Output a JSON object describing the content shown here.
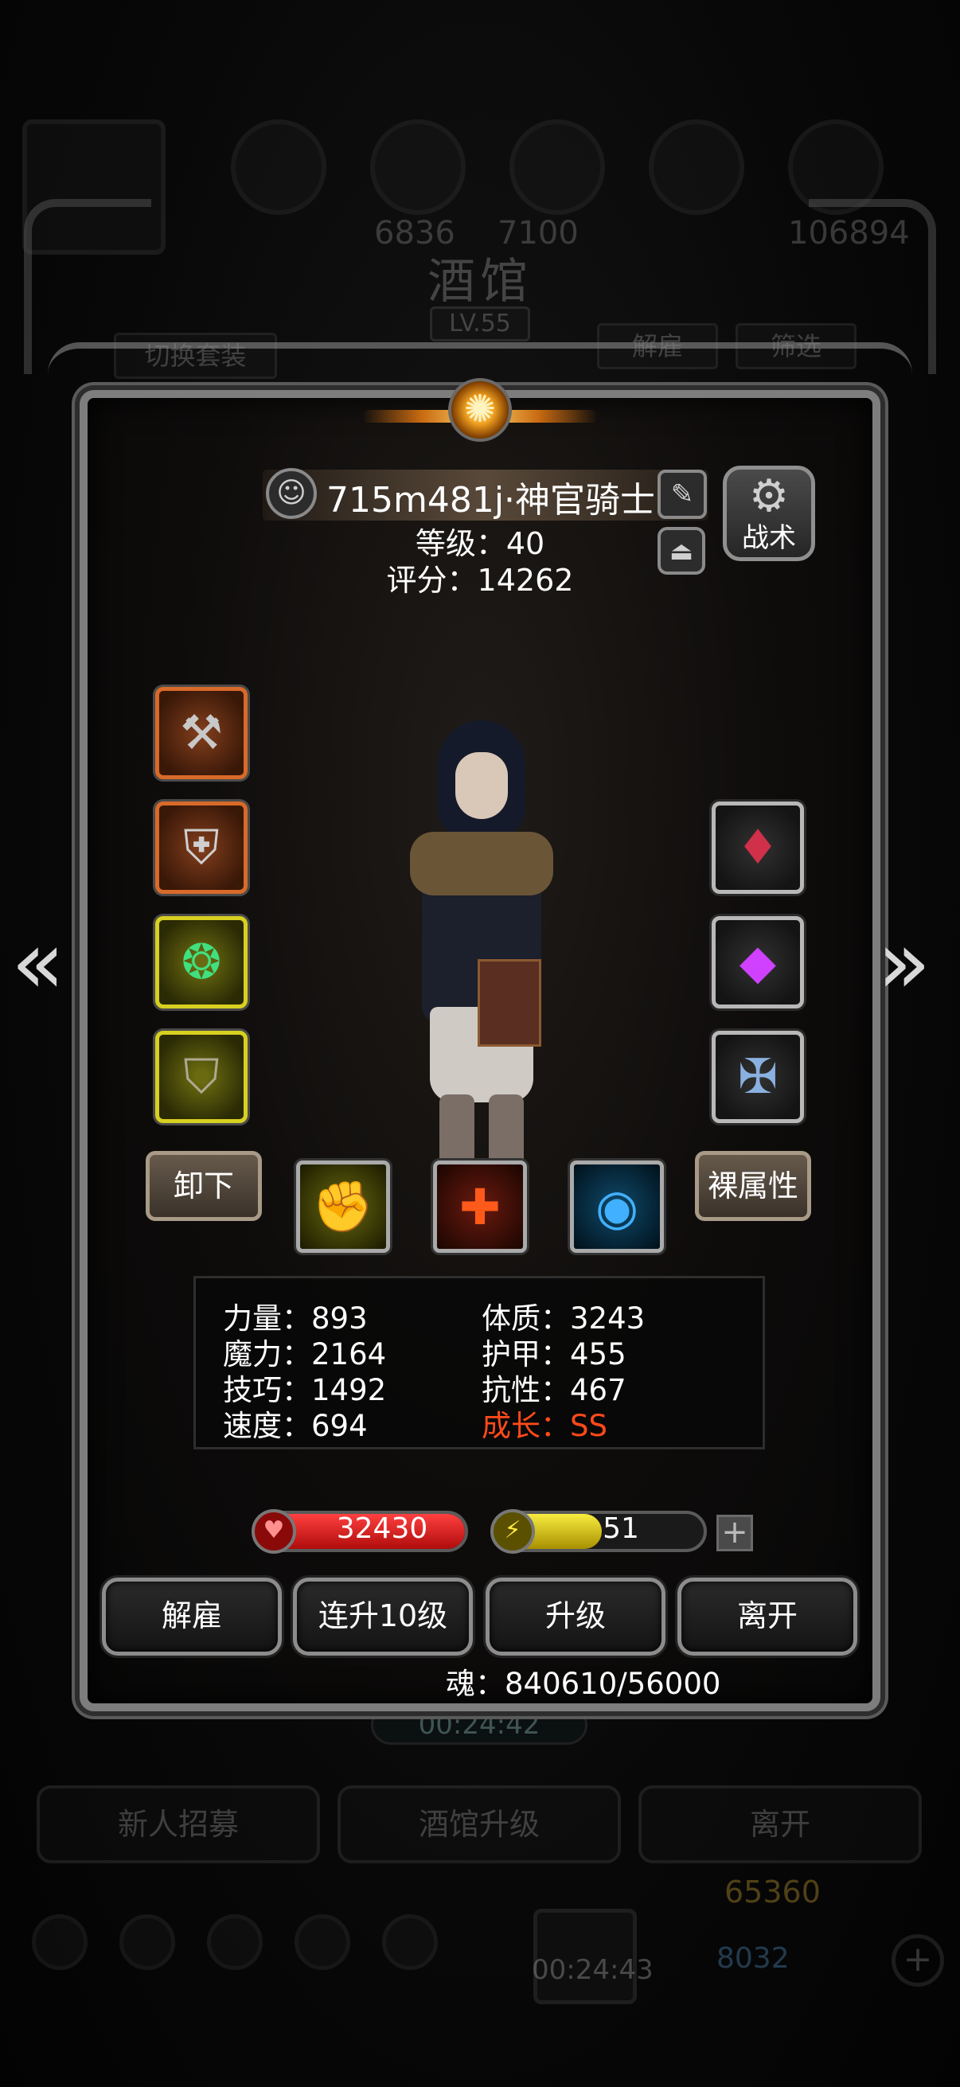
{
  "background": {
    "title": "酒馆",
    "level": "LV.55",
    "switch_outfit": "切换套装",
    "dismiss": "解雇",
    "filter": "筛选",
    "stats": [
      "6836",
      "7100",
      "106894"
    ],
    "timer": "00:24:42",
    "timer2": "00:24:43",
    "recruit": "新人招募",
    "tavern_upgrade": "酒馆升级",
    "leave": "离开",
    "gold": "65360",
    "gems": "8032"
  },
  "hero": {
    "name": "715m481j·神官骑士",
    "level_text": "等级：40",
    "score_text": "评分：14262",
    "tactics_label": "战术"
  },
  "equipment": {
    "left": [
      {
        "icon": "hammer-icon",
        "glyph": "⚒",
        "rarity": "orange"
      },
      {
        "icon": "armor-icon",
        "glyph": "⛨",
        "rarity": "orange"
      },
      {
        "icon": "necklace-icon",
        "glyph": "❂",
        "rarity": "yellow"
      },
      {
        "icon": "shield-icon",
        "glyph": "⛉",
        "rarity": "yellow"
      }
    ],
    "right": [
      {
        "icon": "red-gem-icon",
        "glyph": "♦",
        "rarity": "dark",
        "color": "#d0304a"
      },
      {
        "icon": "purple-gem-icon",
        "glyph": "◆",
        "rarity": "dark",
        "color": "#d040ff"
      },
      {
        "icon": "sword-emblem-icon",
        "glyph": "✠",
        "rarity": "dark",
        "color": "#8ab0e0"
      }
    ]
  },
  "actions": {
    "unequip": "卸下",
    "base_attr": "裸属性",
    "skills": [
      {
        "icon": "fist-skill-icon",
        "glyph": "✊",
        "color": "#e8e020",
        "bg": "#3a3a05"
      },
      {
        "icon": "heal-cross-skill-icon",
        "glyph": "✚",
        "color": "#ff5a1a",
        "bg": "#3a0a05"
      },
      {
        "icon": "eye-skill-icon",
        "glyph": "◉",
        "color": "#40b0ff",
        "bg": "#05203a"
      }
    ]
  },
  "stats": {
    "strength": "力量：893",
    "magic": "魔力：2164",
    "skill": "技巧：1492",
    "speed": "速度：694",
    "constitution": "体质：3243",
    "armor": "护甲：455",
    "resistance": "抗性：467",
    "growth": "成长：SS"
  },
  "bars": {
    "hp": "32430",
    "hp_fill": 1.0,
    "energy": "51",
    "energy_fill": 0.51
  },
  "buttons": {
    "dismiss": "解雇",
    "upgrade10": "连升10级",
    "upgrade": "升级",
    "leave": "离开"
  },
  "soul": "魂：840610/56000",
  "colors": {
    "hp_bar": "#d41818",
    "energy_bar": "#d8c820",
    "growth": "#ff4a1a"
  }
}
